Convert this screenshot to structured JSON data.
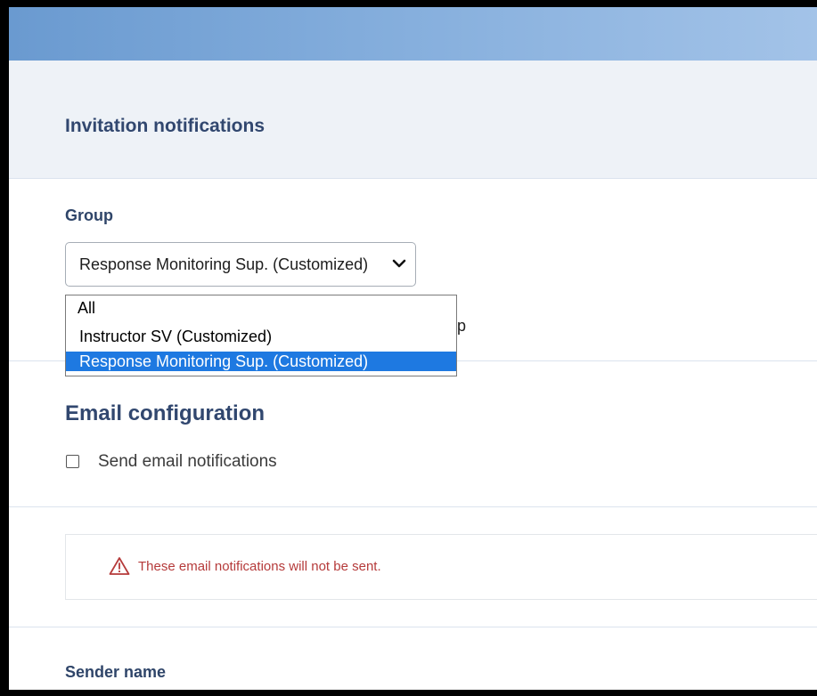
{
  "section": {
    "title": "Invitation notifications"
  },
  "group": {
    "label": "Group",
    "selected_value": "Response Monitoring Sup. (Customized)",
    "options": [
      {
        "label": "All"
      },
      {
        "label": "Instructor SV (Customized)"
      },
      {
        "label": "Response Monitoring Sup. (Customized)"
      }
    ],
    "partial_glyph": "p"
  },
  "email_config": {
    "heading": "Email configuration",
    "checkbox_label": "Send email notifications",
    "checkbox_checked": false
  },
  "alert": {
    "icon": "warning-triangle-icon",
    "message": "These email notifications will not be sent.",
    "color": "#b53a3a"
  },
  "sender": {
    "label": "Sender name"
  },
  "colors": {
    "selection": "#1e79e1",
    "heading": "#31476f",
    "header_band": "#eef2f7"
  }
}
